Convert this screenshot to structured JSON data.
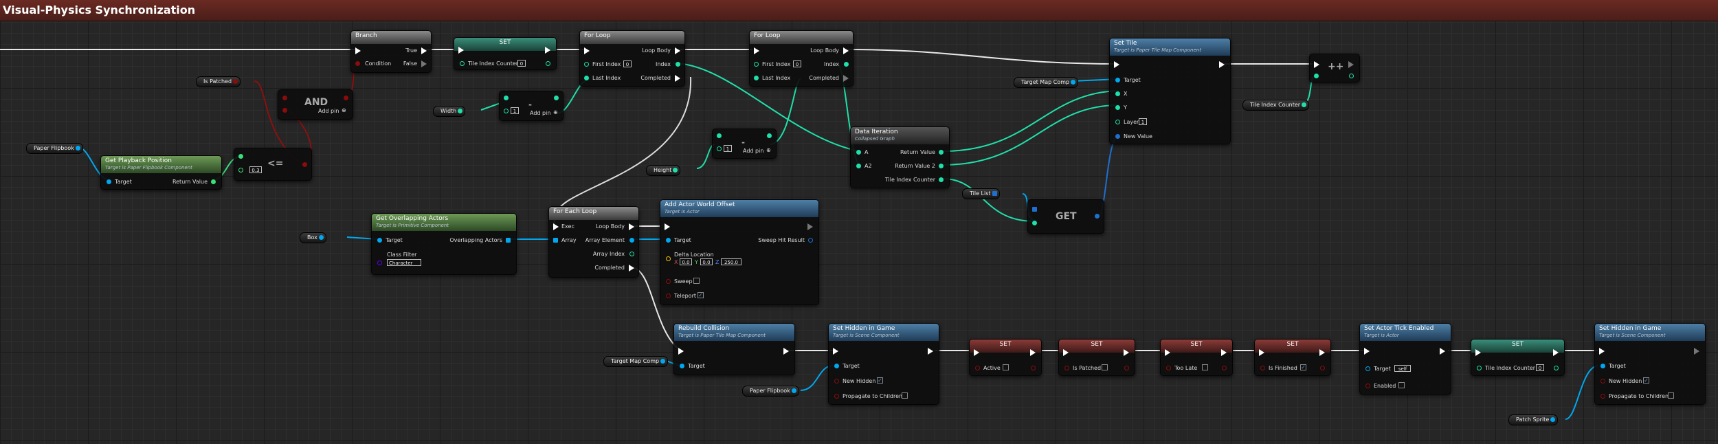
{
  "window": {
    "title": "Visual-Physics Synchronization"
  },
  "nodes": {
    "branch": {
      "title": "Branch",
      "true": "True",
      "false": "False",
      "condition": "Condition"
    },
    "set_counter": {
      "title": "SET",
      "pin": "Tile Index Counter",
      "value": "0"
    },
    "forloop1": {
      "title": "For Loop",
      "loop_body": "Loop Body",
      "first": "First Index",
      "first_value": "0",
      "last": "Last Index",
      "index": "Index",
      "completed": "Completed"
    },
    "forloop2": {
      "title": "For Loop",
      "loop_body": "Loop Body",
      "first": "First Index",
      "first_value": "0",
      "last": "Last Index",
      "index": "Index",
      "completed": "Completed"
    },
    "settile": {
      "title": "Set Tile",
      "subtitle": "Target is Paper Tile Map Component",
      "target": "Target",
      "x": "X",
      "y": "Y",
      "layer": "Layer",
      "layer_value": "1",
      "new_value": "New Value"
    },
    "incr": {
      "title": "++"
    },
    "and": {
      "title": "AND",
      "addpin": "Add pin"
    },
    "minus1": {
      "value": "1",
      "addpin": "Add pin"
    },
    "minus2": {
      "value": "1",
      "addpin": "Add pin"
    },
    "lte": {
      "title": "<=",
      "value": "0.3"
    },
    "playback": {
      "title": "Get Playback Position",
      "subtitle": "Target is Paper Flipbook Component",
      "target": "Target",
      "ret": "Return Value"
    },
    "dataiter": {
      "title": "Data Iteration",
      "subtitle": "Collapsed Graph",
      "a": "A",
      "a2": "A2",
      "ret": "Return Value",
      "ret2": "Return Value 2",
      "counter": "Tile Index Counter"
    },
    "get": {
      "title": "GET"
    },
    "overlap": {
      "title": "Get Overlapping Actors",
      "subtitle": "Target is Primitive Component",
      "target": "Target",
      "out": "Overlapping Actors",
      "filter": "Class Filter",
      "filter_value": "Character"
    },
    "foreach": {
      "title": "For Each Loop",
      "exec": "Exec",
      "array": "Array",
      "loop_body": "Loop Body",
      "element": "Array Element",
      "index": "Array Index",
      "completed": "Completed"
    },
    "offset": {
      "title": "Add Actor World Offset",
      "subtitle": "Target is Actor",
      "target": "Target",
      "hit": "Sweep Hit Result",
      "delta": "Delta Location",
      "x": "0.0",
      "y": "0.0",
      "z": "250.0",
      "sweep": "Sweep",
      "teleport": "Teleport"
    },
    "rebuild": {
      "title": "Rebuild Collision",
      "subtitle": "Target is Paper Tile Map Component",
      "target": "Target"
    },
    "hidden1": {
      "title": "Set Hidden in Game",
      "subtitle": "Target is Scene Component",
      "target": "Target",
      "new_hidden": "New Hidden",
      "propagate": "Propagate to Children"
    },
    "set_active": {
      "title": "SET",
      "pin": "Active"
    },
    "set_patched": {
      "title": "SET",
      "pin": "Is Patched"
    },
    "set_toolate": {
      "title": "SET",
      "pin": "Too Late"
    },
    "set_finished": {
      "title": "SET",
      "pin": "Is Finished"
    },
    "tick": {
      "title": "Set Actor Tick Enabled",
      "subtitle": "Target is Actor",
      "target": "Target",
      "self": "self",
      "enabled": "Enabled"
    },
    "set_counter2": {
      "title": "SET",
      "pin": "Tile Index Counter",
      "value": "0"
    },
    "hidden2": {
      "title": "Set Hidden in Game",
      "subtitle": "Target is Scene Component",
      "target": "Target",
      "new_hidden": "New Hidden",
      "propagate": "Propagate to Children"
    }
  },
  "variables": {
    "is_patched": "Is Patched",
    "paper_flipbook": "Paper Flipbook",
    "width": "Width",
    "height": "Height",
    "box": "Box",
    "target_map_comp": "Target Map Comp",
    "tile_list": "Tile List",
    "tile_index_counter": "Tile Index Counter",
    "target_map_comp2": "Target Map Comp",
    "paper_flipbook2": "Paper Flipbook",
    "patch_sprite": "Patch Sprite"
  },
  "colors": {
    "exec_wire": "#ffffff",
    "object_pin": "#00a8f0",
    "float_pin": "#39e07a",
    "int_pin": "#1fe0aa",
    "bool_pin": "#8a0c0c",
    "struct_pin": "#f0c000",
    "class_pin": "#5a00f0",
    "title_bar": "#5a241e"
  }
}
